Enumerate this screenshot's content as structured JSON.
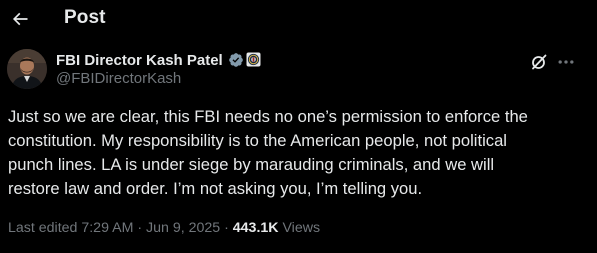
{
  "header": {
    "back_icon": "arrow-left-icon",
    "title": "Post"
  },
  "author": {
    "name": "FBI Director Kash Patel",
    "handle": "@FBIDirectorKash",
    "verified_icon": "verified-badge-icon",
    "affiliation_icon": "fbi-seal-icon",
    "avatar_icon": "avatar-photo"
  },
  "actions": {
    "grok_icon": "grok-icon",
    "more_icon": "more-horizontal-icon"
  },
  "tweet": {
    "lines": [
      "Just so we are clear, this FBI needs no one’s permission to enforce the",
      "constitution. My responsibility is to the American people, not political",
      "punch lines. LA is under siege by marauding criminals, and we will",
      "restore law and order. I’m not asking you, I’m telling you."
    ]
  },
  "meta": {
    "edited": "Last edited 7:29 AM · Jun 9, 2025 · ",
    "views_count": "443.1K",
    "views_label": " Views"
  },
  "colors": {
    "background": "#000000",
    "text_primary": "#e7e9ea",
    "text_secondary": "#71767b",
    "verified": "#1d9bf0"
  }
}
